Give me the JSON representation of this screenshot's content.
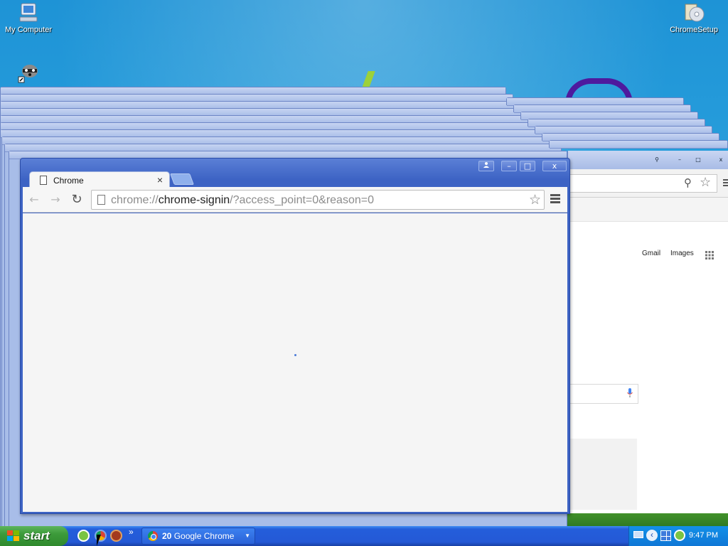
{
  "desktop": {
    "icons": [
      {
        "label": "My Computer",
        "icon": "computer-icon"
      },
      {
        "label": "ChromeSetup",
        "icon": "installer-cd-icon"
      },
      {
        "label": "",
        "icon": "raccoon-shortcut-icon"
      }
    ]
  },
  "main_window": {
    "tab_title": "Chrome",
    "tab_close": "×",
    "url_scheme": "chrome://",
    "url_host": "chrome-signin",
    "url_rest": "/?access_point=0&reason=0",
    "back": "←",
    "forward": "→",
    "reload": "↻",
    "star": "☆",
    "minimize": "–",
    "maximize": "□",
    "close": "x"
  },
  "background_window": {
    "links": [
      "Gmail",
      "Images"
    ]
  },
  "taskbar": {
    "start_label": "start",
    "overflow": "»",
    "task_count": "20",
    "task_label": "Google Chrome",
    "clock": "9:47 PM"
  },
  "colors": {
    "titlebar": "#3d63c4",
    "taskbar": "#245edb",
    "start_button": "#3c9a3a"
  }
}
